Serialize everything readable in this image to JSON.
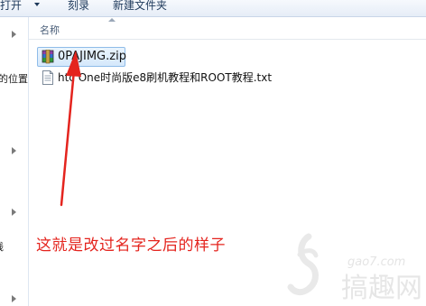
{
  "toolbar": {
    "open_label": "打开",
    "burn_label": "刻录",
    "new_folder_label": "新建文件夹"
  },
  "nav": {
    "fragment_location": "的位置",
    "fragment_network": "线"
  },
  "columns": {
    "name_header": "名称"
  },
  "files": [
    {
      "name": "0PAJIMG.zip",
      "icon": "winrar-archive-icon",
      "selected": true
    },
    {
      "name": "htc One时尚版e8刷机教程和ROOT教程.txt",
      "icon": "text-file-icon",
      "selected": false
    }
  ],
  "annotation": {
    "text": "这就是改过名字之后的样子",
    "color": "#e4241e"
  },
  "watermark": {
    "domain": "gao7.com",
    "brand": "搞趣网"
  },
  "colors": {
    "selection_fill": "#d5e8fb",
    "selection_border": "#8fbce9",
    "toolbar_text": "#1e395b"
  }
}
